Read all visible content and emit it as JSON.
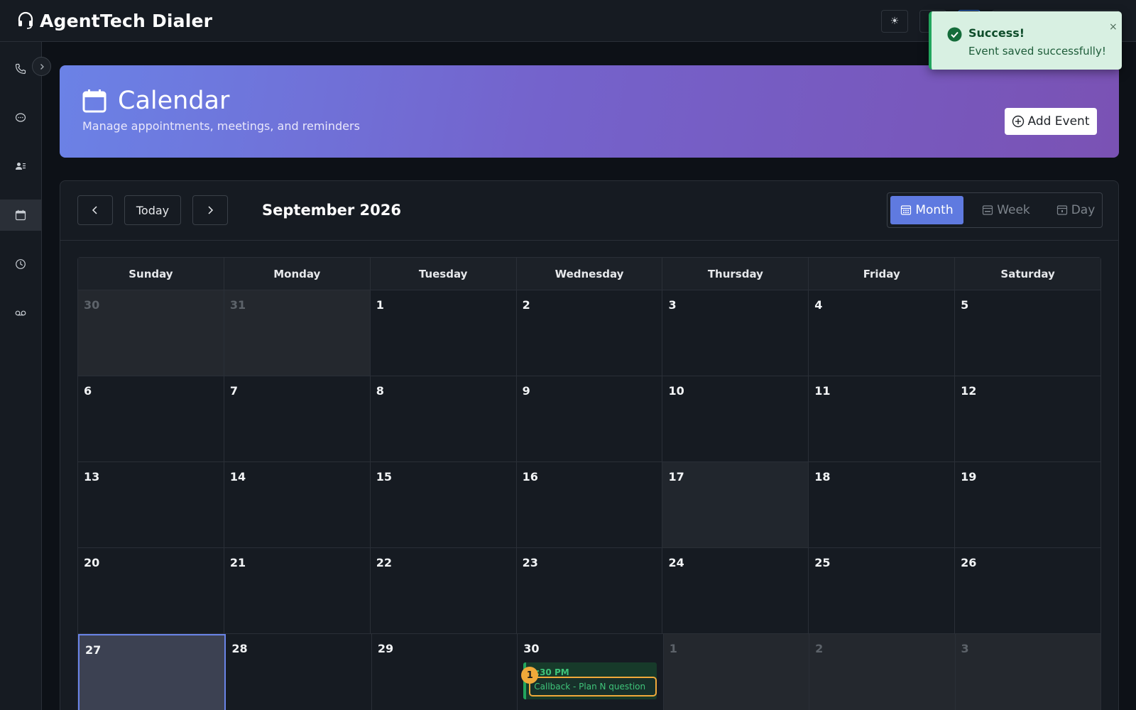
{
  "app": {
    "title": "AgentTech Dialer"
  },
  "topbar": {
    "theme_icon": "sun-icon"
  },
  "sidebar": {
    "items": [
      {
        "icon": "phone-icon",
        "active": false
      },
      {
        "icon": "chat-icon",
        "active": false
      },
      {
        "icon": "contacts-icon",
        "active": false
      },
      {
        "icon": "calendar-icon",
        "active": true
      },
      {
        "icon": "history-icon",
        "active": false
      },
      {
        "icon": "voicemail-icon",
        "active": false
      }
    ]
  },
  "header": {
    "title": "Calendar",
    "subtitle": "Manage appointments, meetings, and reminders",
    "add_event_label": "Add Event"
  },
  "calendar": {
    "today_label": "Today",
    "month_title": "September 2026",
    "views": {
      "month": "Month",
      "week": "Week",
      "day": "Day",
      "active": "month"
    },
    "weekdays": [
      "Sunday",
      "Monday",
      "Tuesday",
      "Wednesday",
      "Thursday",
      "Friday",
      "Saturday"
    ],
    "weeks": [
      [
        "30",
        "31",
        "1",
        "2",
        "3",
        "4",
        "5"
      ],
      [
        "6",
        "7",
        "8",
        "9",
        "10",
        "11",
        "12"
      ],
      [
        "13",
        "14",
        "15",
        "16",
        "17",
        "18",
        "19"
      ],
      [
        "20",
        "21",
        "22",
        "23",
        "24",
        "25",
        "26"
      ],
      [
        "27",
        "28",
        "29",
        "30",
        "1",
        "2",
        "3"
      ]
    ],
    "event": {
      "time": ":30 PM",
      "title": "Callback - Plan N question",
      "badge": "1"
    }
  },
  "toast": {
    "title": "Success!",
    "message": "Event saved successfully!",
    "close": "×"
  },
  "colors": {
    "accent": "#5f7ae0",
    "success": "#22a55d",
    "highlight": "#f0a93a"
  }
}
